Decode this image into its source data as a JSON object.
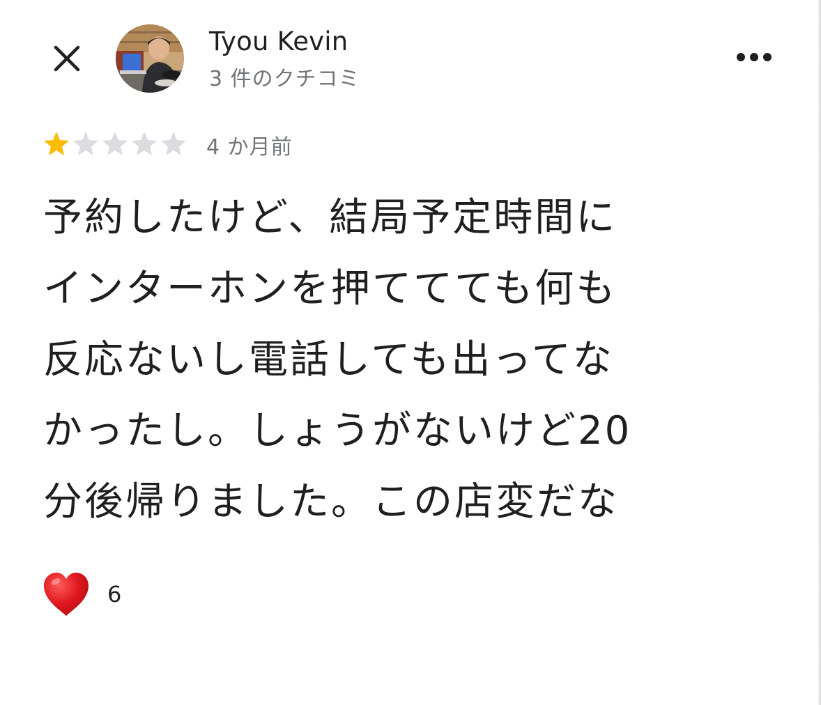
{
  "reviewer": {
    "name": "Tyou Kevin",
    "review_count": "3 件のクチコミ"
  },
  "review": {
    "rating": 1,
    "max_rating": 5,
    "time_ago": "4 か月前",
    "text": "予約したけど、結局予定時間に\nインターホンを押ててても何も\n反応ないし電話しても出ってな\nかったし。しょうがないけど20\n分後帰りました。この店変だな",
    "likes": "6"
  },
  "icons": {
    "close": "close-icon",
    "more": "more-horizontal-icon",
    "heart": "heart-icon",
    "star_filled": "star-filled-icon",
    "star_empty": "star-empty-icon"
  },
  "colors": {
    "star_filled": "#fbbc04",
    "star_empty": "#dadce0",
    "heart": "#e0191f",
    "secondary_text": "#70757a",
    "primary_text": "#1f1f1f"
  }
}
